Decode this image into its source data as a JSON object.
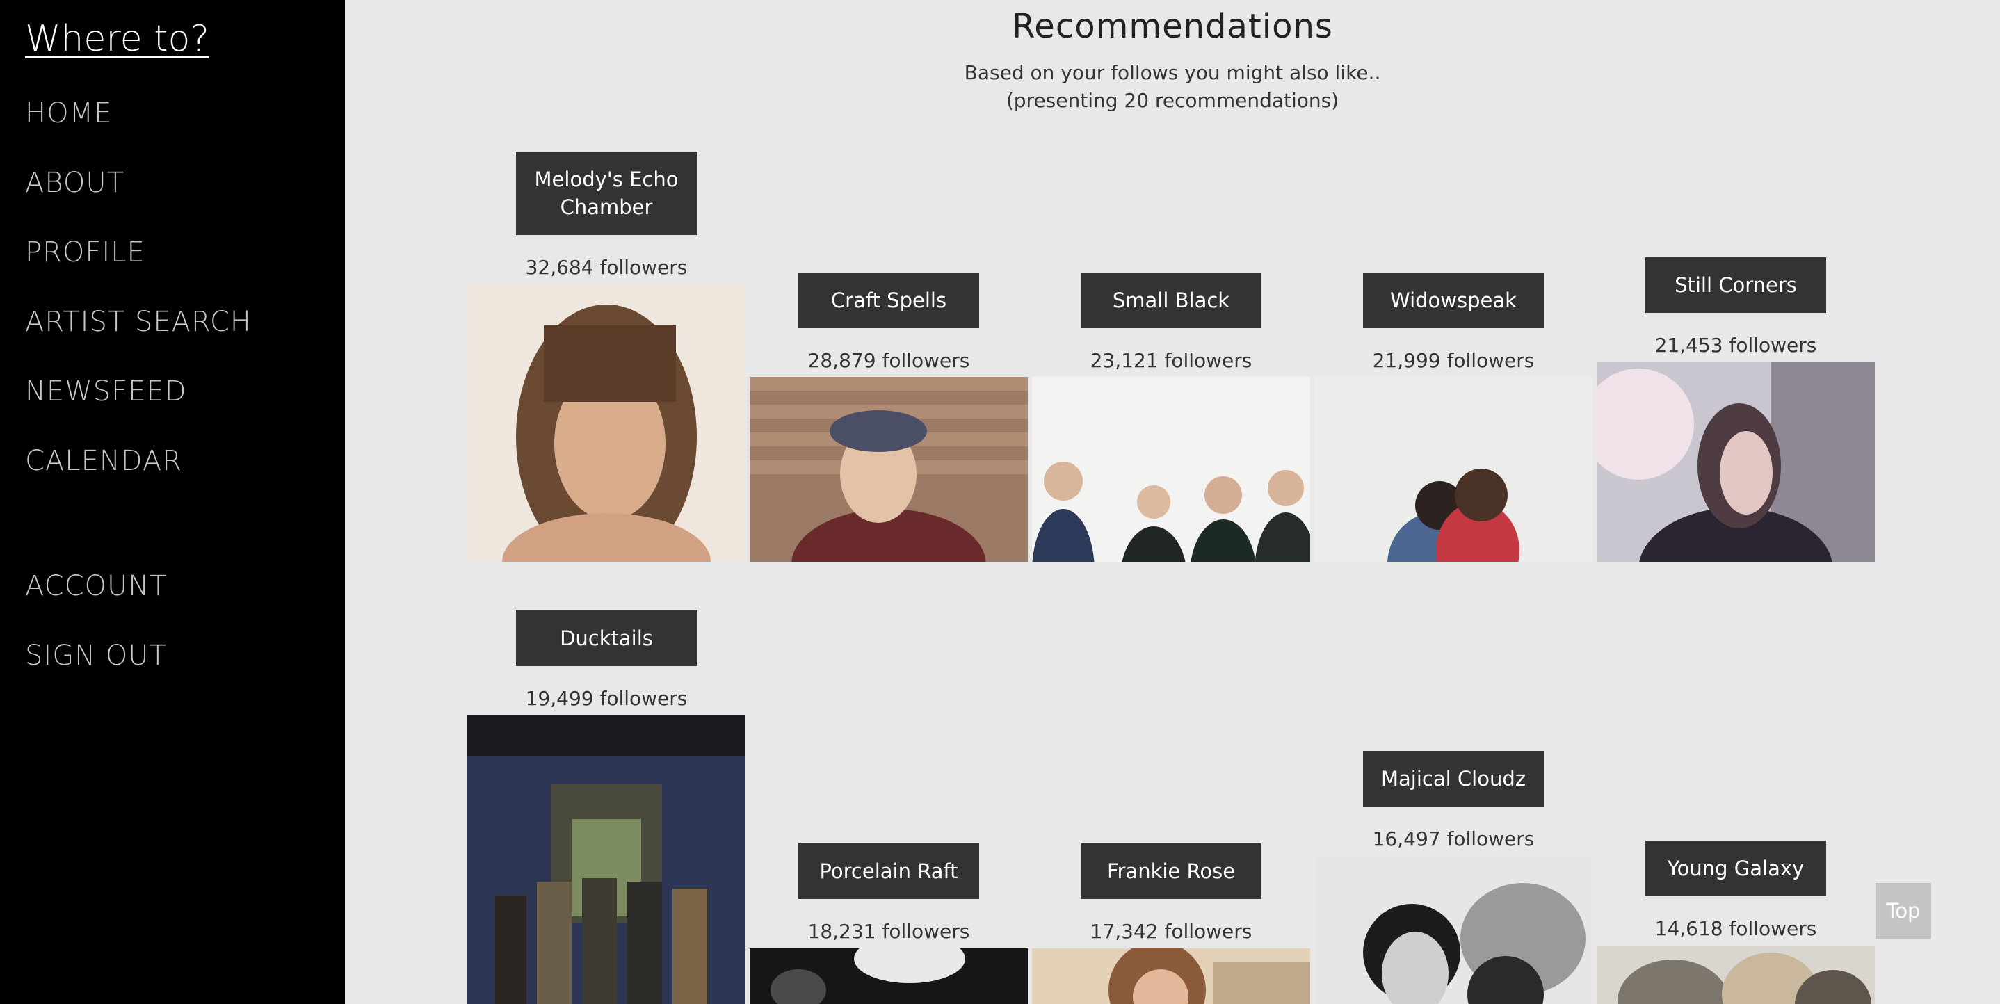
{
  "sidebar": {
    "brand": "Where to?",
    "nav": [
      "HOME",
      "ABOUT",
      "PROFILE",
      "ARTIST SEARCH",
      "NEWSFEED",
      "CALENDAR"
    ],
    "account_nav": [
      "ACCOUNT",
      "SIGN OUT"
    ]
  },
  "main": {
    "title": "Recommendations",
    "subtitle_line1": "Based on your follows you might also like..",
    "subtitle_line2": "(presenting 20 recommendations)"
  },
  "recommendations": [
    {
      "name": "Melody's Echo Chamber",
      "followers": "32,684 followers"
    },
    {
      "name": "Craft Spells",
      "followers": "28,879 followers"
    },
    {
      "name": "Small Black",
      "followers": "23,121 followers"
    },
    {
      "name": "Widowspeak",
      "followers": "21,999 followers"
    },
    {
      "name": "Still Corners",
      "followers": "21,453 followers"
    },
    {
      "name": "Ducktails",
      "followers": "19,499 followers"
    },
    {
      "name": "Porcelain Raft",
      "followers": "18,231 followers"
    },
    {
      "name": "Frankie Rose",
      "followers": "17,342 followers"
    },
    {
      "name": "Majical Cloudz",
      "followers": "16,497 followers"
    },
    {
      "name": "Young Galaxy",
      "followers": "14,618 followers"
    }
  ],
  "top_button": "Top"
}
